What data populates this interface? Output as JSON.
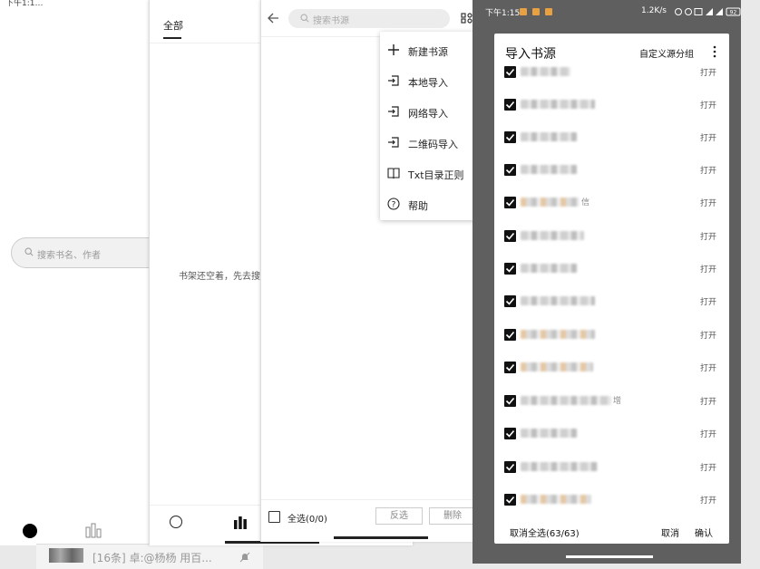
{
  "phone1": {
    "status": "下午1:1…",
    "search_placeholder": "搜索书名、作者"
  },
  "taskbar": {
    "notice": "[16条] 卓:@杨杨 用百..."
  },
  "phone2": {
    "tab_all": "全部",
    "empty_message": "书架还空着，先去搜索"
  },
  "phone3": {
    "search_placeholder": "搜索书源",
    "menu": [
      {
        "label": "新建书源",
        "icon": "plus-icon"
      },
      {
        "label": "本地导入",
        "icon": "import-icon"
      },
      {
        "label": "网络导入",
        "icon": "import-icon"
      },
      {
        "label": "二维码导入",
        "icon": "import-icon"
      },
      {
        "label": "Txt目录正则",
        "icon": "book-icon"
      },
      {
        "label": "帮助",
        "icon": "help-icon"
      }
    ],
    "select_all": "全选(0/0)",
    "invert": "反选",
    "delete": "删除"
  },
  "phone4": {
    "status_time": "下午1:15",
    "status_net": "1.2K/s",
    "battery": "92",
    "dialog": {
      "title": "导入书源",
      "custom_group": "自定义源分组",
      "open_label": "打开",
      "cancel_all": "取消全选(63/63)",
      "cancel": "取消",
      "confirm": "确认"
    },
    "rows": [
      {
        "tail": "",
        "open": "打开"
      },
      {
        "tail": "",
        "open": "打开"
      },
      {
        "tail": "",
        "open": "打开"
      },
      {
        "tail": "",
        "open": "打开"
      },
      {
        "tail": "信",
        "open": "打开"
      },
      {
        "tail": "",
        "open": "打开"
      },
      {
        "tail": "",
        "open": "打开"
      },
      {
        "tail": "",
        "open": "打开"
      },
      {
        "tail": "",
        "open": "打开"
      },
      {
        "tail": "",
        "open": "打开"
      },
      {
        "tail": "增",
        "open": "打开"
      },
      {
        "tail": "",
        "open": "打开"
      },
      {
        "tail": "",
        "open": "打开"
      },
      {
        "tail": "",
        "open": "打开"
      }
    ]
  },
  "colors": {
    "dark_overlay": "#5f5f5f",
    "checkbox": "#111111",
    "text": "#222222"
  }
}
